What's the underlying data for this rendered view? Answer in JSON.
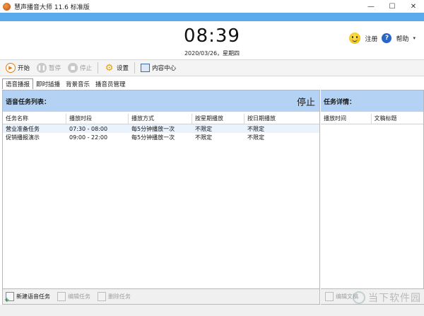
{
  "window": {
    "title": "慧声播音大师 11.6 标准版",
    "minimize": "—",
    "maximize": "☐",
    "close": "✕"
  },
  "header": {
    "clock": "08:39",
    "date": "2020/03/26，星期四",
    "register_label": "注册",
    "help_label": "帮助",
    "help_glyph": "?",
    "caret": "▾"
  },
  "toolbar": {
    "start_label": "开始",
    "pause_label": "暂停",
    "stop_label": "停止",
    "settings_label": "设置",
    "content_center_label": "内容中心"
  },
  "tabs": [
    {
      "label": "语音播报",
      "active": true
    },
    {
      "label": "即时插播",
      "active": false
    },
    {
      "label": "背景音乐",
      "active": false
    },
    {
      "label": "播音员管理",
      "active": false
    }
  ],
  "left_panel": {
    "title": "语音任务列表：",
    "status": "停止",
    "columns": [
      "任务名称",
      "播放时段",
      "播放方式",
      "按星期播放",
      "按日期播放"
    ],
    "rows": [
      [
        "营业准备任务",
        "07:30 - 08:00",
        "每5分钟播放一次",
        "不限定",
        "不限定"
      ],
      [
        "促销播报演示",
        "09:00 - 22:00",
        "每5分钟播放一次",
        "不限定",
        "不限定"
      ]
    ],
    "bottom": {
      "new_label": "新建语音任务",
      "edit_label": "编辑任务",
      "delete_label": "删除任务"
    }
  },
  "right_panel": {
    "title": "任务详情：",
    "columns": [
      "播放时间",
      "文稿标题"
    ],
    "bottom_label": "编辑文稿"
  },
  "watermark": {
    "text": "当下软件园"
  }
}
